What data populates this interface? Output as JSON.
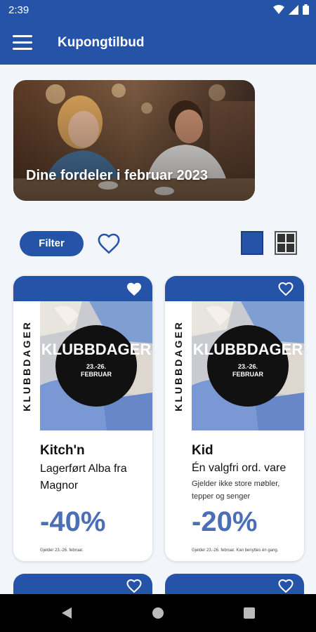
{
  "status": {
    "time": "2:39"
  },
  "app_bar": {
    "title": "Kupongtilbud"
  },
  "hero": {
    "text": "Dine fordeler i februar 2023"
  },
  "controls": {
    "filter_label": "Filter"
  },
  "cards": [
    {
      "side_label": "KLUBBDAGER",
      "badge_word": "KLUBBDAGER",
      "badge_date": "23.-26.",
      "badge_month": "FEBRUAR",
      "store": "Kitch'n",
      "title": "Lagerført Alba fra Magnor",
      "subtitle": "",
      "discount": "-40%",
      "fine_print": "Gjelder 23.-26. februar."
    },
    {
      "side_label": "KLUBBDAGER",
      "badge_word": "KLUBBDAGER",
      "badge_date": "23.-26.",
      "badge_month": "FEBRUAR",
      "store": "Kid",
      "title": "Én valgfri ord. vare",
      "subtitle": "Gjelder ikke store møbler, tepper og senger",
      "discount": "-20%",
      "fine_print": "Gjelder 23.-26. februar. Kan benyttes én gang."
    }
  ],
  "colors": {
    "primary": "#2553a8",
    "discount": "#4a6fb5",
    "background": "#f2f5fa"
  }
}
